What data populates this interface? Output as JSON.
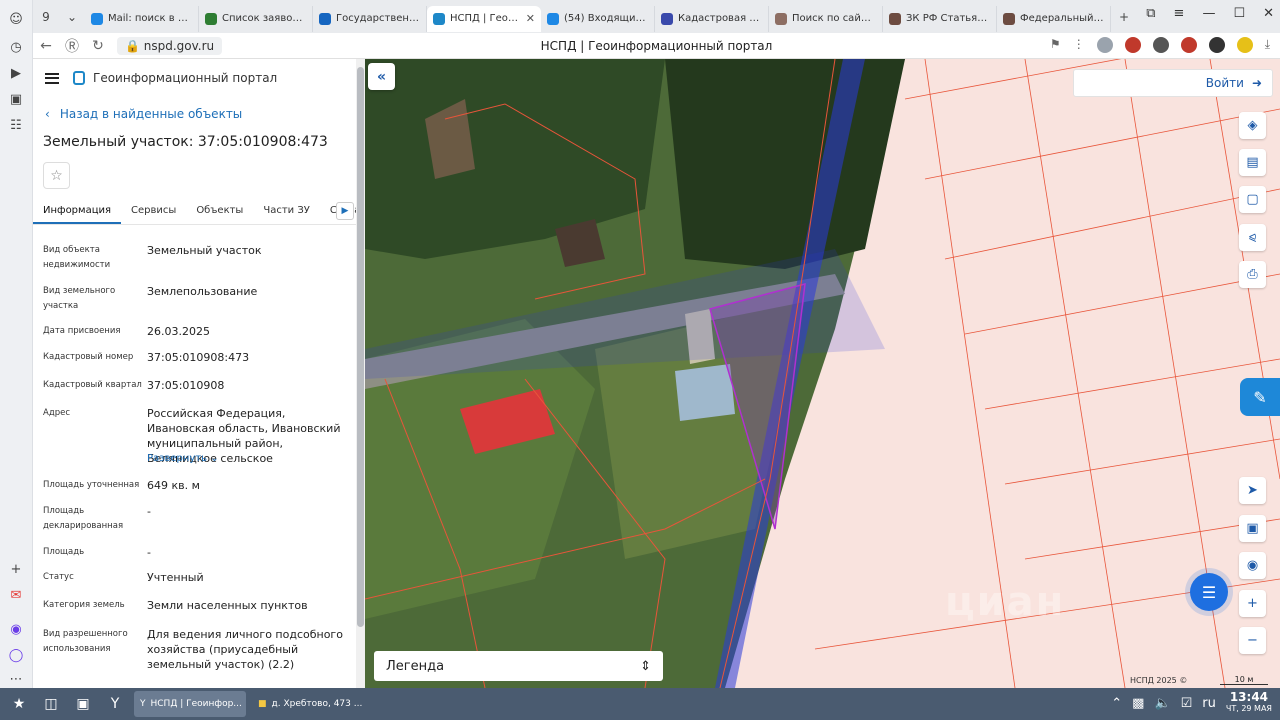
{
  "browser": {
    "tab_count": "9",
    "tabs": [
      {
        "title": "Mail: поиск в интернете",
        "color": "#1e88e5"
      },
      {
        "title": "Список заявок — Тасс",
        "color": "#2e7d32"
      },
      {
        "title": "Государственная информационная",
        "color": "#1565c0"
      },
      {
        "title": "НСПД | Геоинформационный портал",
        "color": "#1e88c8"
      },
      {
        "title": "(54) Входящие - Почта",
        "color": "#1e88e5"
      },
      {
        "title": "Кадастровая карта",
        "color": "#3949ab"
      },
      {
        "title": "Поиск по сайту \\ Ко",
        "color": "#8d6e63"
      },
      {
        "title": "ЗК РФ Статья 39.16",
        "color": "#6d4c41"
      },
      {
        "title": "Федеральный закон",
        "color": "#6d4c41"
      }
    ],
    "url": "nspd.gov.ru",
    "page_title": "НСПД | Геоинформационный портал",
    "login_badge": "Войти"
  },
  "panel": {
    "portal_name": "Геоинформационный портал",
    "back_label": "Назад в найденные объекты",
    "title": "Земельный участок: 37:05:010908:473",
    "tabs": [
      "Информация",
      "Сервисы",
      "Объекты",
      "Части ЗУ",
      "Состав"
    ],
    "fields": [
      {
        "label": "Вид объекта недвижимости",
        "value": "Земельный участок"
      },
      {
        "label": "Вид земельного участка",
        "value": "Землепользование"
      },
      {
        "label": "Дата присвоения",
        "value": "26.03.2025"
      },
      {
        "label": "Кадастровый номер",
        "value": "37:05:010908:473"
      },
      {
        "label": "Кадастровый квартал",
        "value": "37:05:010908"
      },
      {
        "label": "Адрес",
        "value": "Российская Федерация, Ивановская область, Ивановский муниципальный район, Беляницкое сельское"
      },
      {
        "label": "Площадь уточненная",
        "value": "649 кв. м"
      },
      {
        "label": "Площадь декларированная",
        "value": "-"
      },
      {
        "label": "Площадь",
        "value": "-"
      },
      {
        "label": "Статус",
        "value": "Учтенный"
      },
      {
        "label": "Категория земель",
        "value": "Земли населенных пунктов"
      },
      {
        "label": "Вид разрешенного использования",
        "value": "Для ведения личного подсобного хозяйства (приусадебный земельный участок) (2.2)"
      }
    ],
    "expand_label": "Развернуть"
  },
  "map": {
    "login_label": "Войти",
    "legend_label": "Легенда",
    "copyright": "НСПД 2025 ©",
    "scale": "10 м",
    "watermark": "циан"
  },
  "taskbar": {
    "tasks": [
      "НСПД | Геоинфор...",
      "д. Хребтово, 473 ..."
    ],
    "lang": "ru",
    "time": "13:44",
    "date": "ЧТ, 29 МАЯ"
  },
  "colors": {
    "accent": "#1e6fb8",
    "parcel_line": "#e8553a",
    "parcel_selected": "#b030d0",
    "road_zone": "#2a3ad8",
    "taskbar": "#4a5b70"
  }
}
